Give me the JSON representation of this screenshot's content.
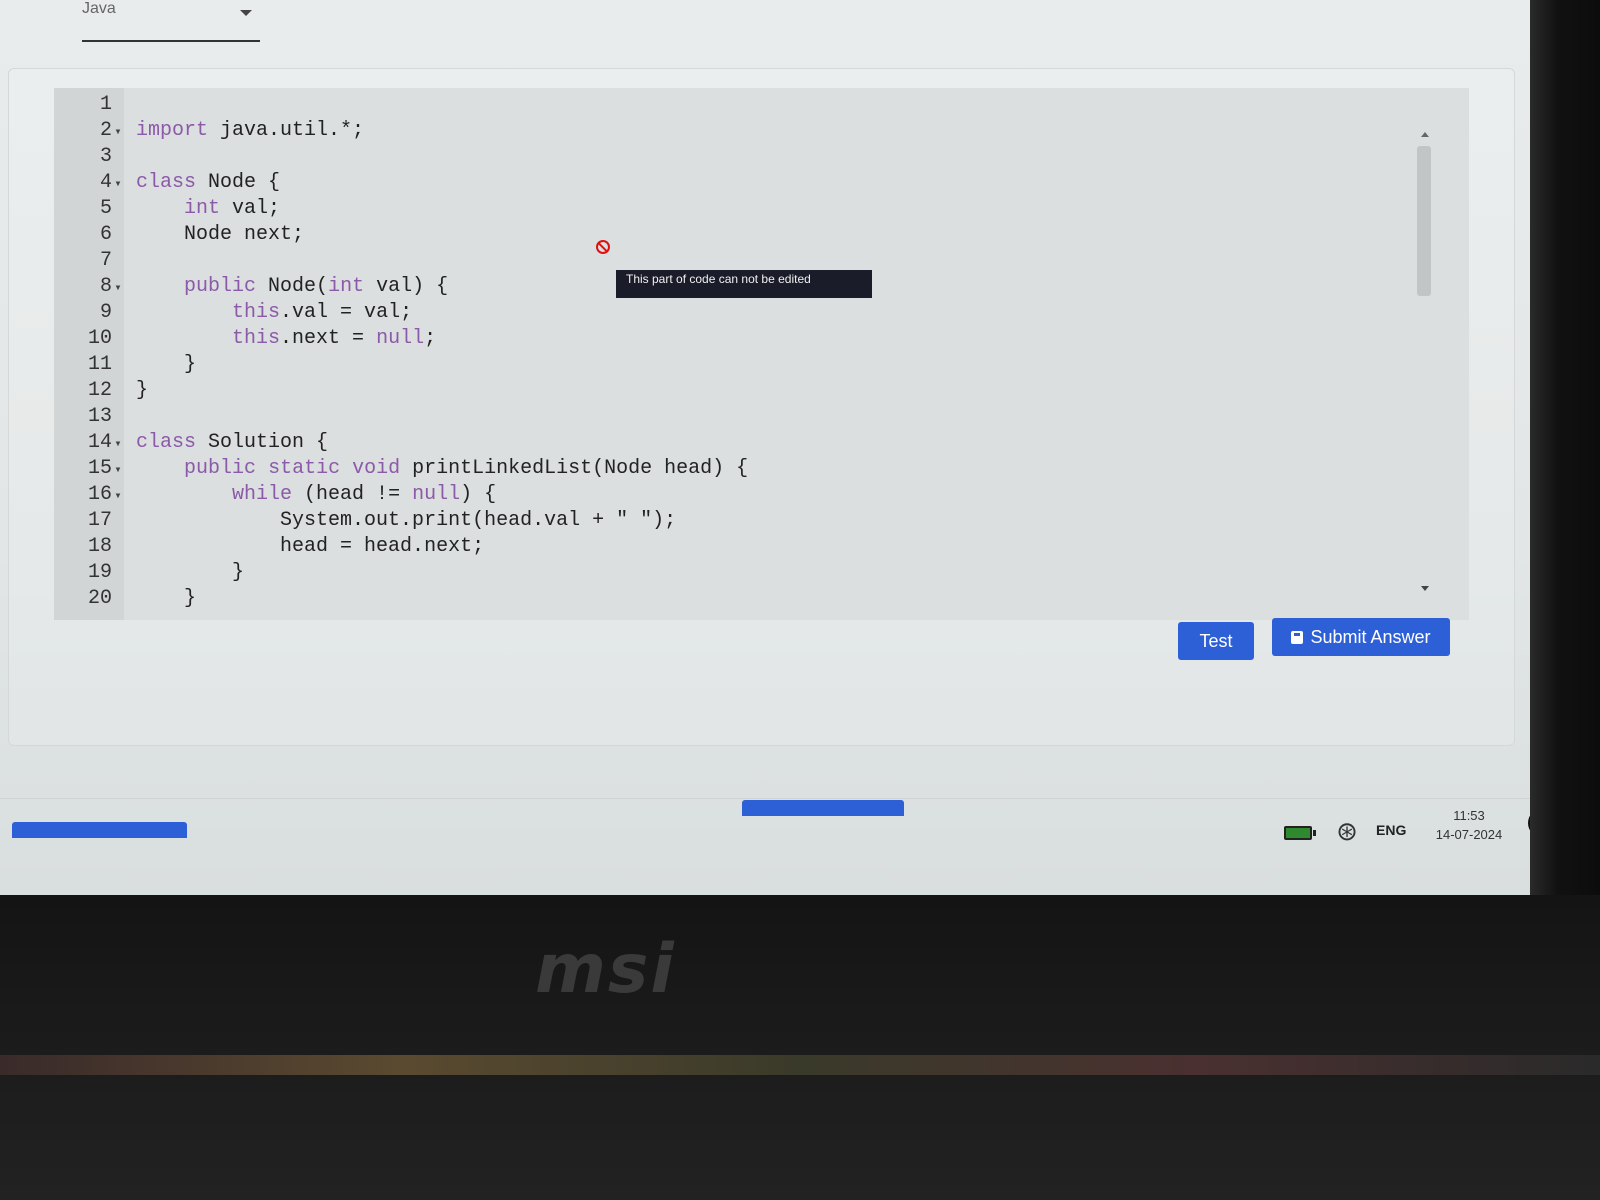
{
  "language_select": {
    "value": "Java"
  },
  "editor": {
    "lines": [
      {
        "n": "1",
        "fold": "",
        "parts": []
      },
      {
        "n": "2",
        "fold": "▾",
        "parts": [
          {
            "k": "kw",
            "t": "import"
          },
          {
            "t": " java.util.*;"
          }
        ]
      },
      {
        "n": "3",
        "fold": "",
        "parts": []
      },
      {
        "n": "4",
        "fold": "▾",
        "parts": [
          {
            "k": "kw",
            "t": "class"
          },
          {
            "t": " Node {"
          }
        ]
      },
      {
        "n": "5",
        "fold": "",
        "parts": [
          {
            "t": "    "
          },
          {
            "k": "kw",
            "t": "int"
          },
          {
            "t": " val;"
          }
        ]
      },
      {
        "n": "6",
        "fold": "",
        "parts": [
          {
            "t": "    Node next;"
          }
        ]
      },
      {
        "n": "7",
        "fold": "",
        "parts": []
      },
      {
        "n": "8",
        "fold": "▾",
        "parts": [
          {
            "t": "    "
          },
          {
            "k": "kw",
            "t": "public"
          },
          {
            "t": " Node("
          },
          {
            "k": "kw",
            "t": "int"
          },
          {
            "t": " val) {"
          }
        ]
      },
      {
        "n": "9",
        "fold": "",
        "parts": [
          {
            "t": "        "
          },
          {
            "k": "kw",
            "t": "this"
          },
          {
            "t": ".val = val;"
          }
        ]
      },
      {
        "n": "10",
        "fold": "",
        "parts": [
          {
            "t": "        "
          },
          {
            "k": "kw",
            "t": "this"
          },
          {
            "t": ".next = "
          },
          {
            "k": "kw",
            "t": "null"
          },
          {
            "t": ";"
          }
        ]
      },
      {
        "n": "11",
        "fold": "",
        "parts": [
          {
            "t": "    }"
          }
        ]
      },
      {
        "n": "12",
        "fold": "",
        "parts": [
          {
            "t": "}"
          }
        ]
      },
      {
        "n": "13",
        "fold": "",
        "parts": []
      },
      {
        "n": "14",
        "fold": "▾",
        "parts": [
          {
            "k": "kw",
            "t": "class"
          },
          {
            "t": " Solution {"
          }
        ]
      },
      {
        "n": "15",
        "fold": "▾",
        "parts": [
          {
            "t": "    "
          },
          {
            "k": "kw",
            "t": "public"
          },
          {
            "t": " "
          },
          {
            "k": "kw",
            "t": "static"
          },
          {
            "t": " "
          },
          {
            "k": "kw",
            "t": "void"
          },
          {
            "t": " printLinkedList(Node head) {"
          }
        ]
      },
      {
        "n": "16",
        "fold": "▾",
        "parts": [
          {
            "t": "        "
          },
          {
            "k": "kw",
            "t": "while"
          },
          {
            "t": " (head != "
          },
          {
            "k": "kw",
            "t": "null"
          },
          {
            "t": ") {"
          }
        ]
      },
      {
        "n": "17",
        "fold": "",
        "parts": [
          {
            "t": "            System.out.print(head.val + \" \");"
          }
        ]
      },
      {
        "n": "18",
        "fold": "",
        "parts": [
          {
            "t": "            head = head.next;"
          }
        ]
      },
      {
        "n": "19",
        "fold": "",
        "parts": [
          {
            "t": "        }"
          }
        ]
      },
      {
        "n": "20",
        "fold": "",
        "parts": [
          {
            "t": "    }"
          }
        ]
      }
    ]
  },
  "tooltip": {
    "text": "This part of code can not be edited"
  },
  "buttons": {
    "test": "Test",
    "submit": "Submit Answer"
  },
  "taskbar": {
    "lang": "ENG",
    "time": "11:53",
    "date": "14-07-2024"
  },
  "device": {
    "brand": "msi"
  },
  "colors": {
    "accent": "#2d5fd6",
    "keyword": "#8b5aa8",
    "error": "#dd1111"
  }
}
